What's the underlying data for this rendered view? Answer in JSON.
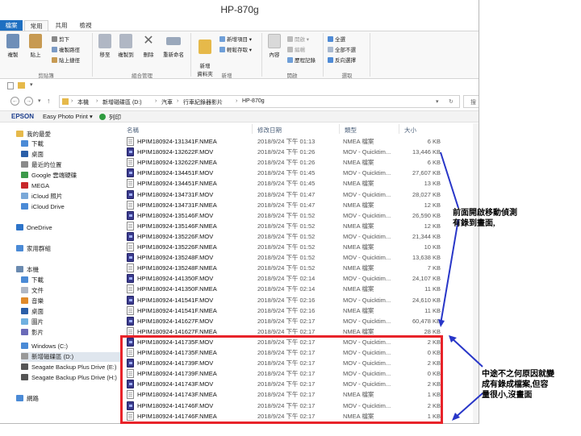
{
  "window": {
    "title": "HP-870g"
  },
  "tabs": [
    {
      "label": "檔案"
    },
    {
      "label": "常用"
    },
    {
      "label": "共用"
    },
    {
      "label": "檢視"
    }
  ],
  "ribbon": {
    "clipboard": {
      "copy": "複製",
      "paste": "貼上",
      "cut": "剪下",
      "copy_path": "複製路徑",
      "paste_shortcut": "貼上捷徑",
      "group": "剪貼簿"
    },
    "organize": {
      "move_to": "移至",
      "copy_to": "複製到",
      "delete": "刪除",
      "rename": "重新命名",
      "group": "組合管理"
    },
    "new": {
      "new_folder": "新增\n資料夾",
      "new_item": "新增項目 ▾",
      "easy_access": "輕鬆存取 ▾",
      "group": "新增"
    },
    "open": {
      "properties": "內容",
      "open": "開啟 ▾",
      "edit": "編輯",
      "history": "歷程記錄",
      "group": "開啟"
    },
    "select": {
      "select_all": "全選",
      "select_none": "全部不選",
      "invert": "反向選擇",
      "group": "選取"
    }
  },
  "address": {
    "crumbs": [
      "本機",
      "新增磁碟區 (D:)",
      "汽車",
      "行車紀錄器影片",
      "HP-870g"
    ],
    "search": "搜"
  },
  "epson": {
    "brand": "EPSON",
    "app": "Easy Photo Print ▾",
    "print": "列印"
  },
  "nav": [
    {
      "label": "我的最愛"
    },
    {
      "label": "下載"
    },
    {
      "label": "桌面"
    },
    {
      "label": "最近的位置"
    },
    {
      "label": "Google 雲端硬碟"
    },
    {
      "label": "MEGA"
    },
    {
      "label": "iCloud 照片"
    },
    {
      "label": "iCloud Drive"
    },
    {
      "label": "OneDrive"
    },
    {
      "label": "家用群組"
    },
    {
      "label": "本機"
    },
    {
      "label": "下載"
    },
    {
      "label": "文件"
    },
    {
      "label": "音樂"
    },
    {
      "label": "桌面"
    },
    {
      "label": "圖片"
    },
    {
      "label": "影片"
    },
    {
      "label": "Windows (C:)"
    },
    {
      "label": "新增磁碟區 (D:)"
    },
    {
      "label": "Seagate Backup Plus Drive (E:)"
    },
    {
      "label": "Seagate Backup Plus Drive (H:)"
    },
    {
      "label": "網路"
    }
  ],
  "columns": {
    "name": "名稱",
    "date": "修改日期",
    "type": "類型",
    "size": "大小"
  },
  "files": [
    {
      "name": "HPIM180924-131341F.NMEA",
      "date": "2018/9/24 下午 01:13",
      "type": "NMEA 檔案",
      "size": "6 KB",
      "kind": "nmea"
    },
    {
      "name": "HPIM180924-132622F.MOV",
      "date": "2018/9/24 下午 01:26",
      "type": "MOV - Quicktim...",
      "size": "13,446 KB",
      "kind": "mov"
    },
    {
      "name": "HPIM180924-132622F.NMEA",
      "date": "2018/9/24 下午 01:26",
      "type": "NMEA 檔案",
      "size": "6 KB",
      "kind": "nmea"
    },
    {
      "name": "HPIM180924-134451F.MOV",
      "date": "2018/9/24 下午 01:45",
      "type": "MOV - Quicktim...",
      "size": "27,607 KB",
      "kind": "mov"
    },
    {
      "name": "HPIM180924-134451F.NMEA",
      "date": "2018/9/24 下午 01:45",
      "type": "NMEA 檔案",
      "size": "13 KB",
      "kind": "nmea"
    },
    {
      "name": "HPIM180924-134731F.MOV",
      "date": "2018/9/24 下午 01:47",
      "type": "MOV - Quicktim...",
      "size": "28,027 KB",
      "kind": "mov"
    },
    {
      "name": "HPIM180924-134731F.NMEA",
      "date": "2018/9/24 下午 01:47",
      "type": "NMEA 檔案",
      "size": "12 KB",
      "kind": "nmea"
    },
    {
      "name": "HPIM180924-135146F.MOV",
      "date": "2018/9/24 下午 01:52",
      "type": "MOV - Quicktim...",
      "size": "26,590 KB",
      "kind": "mov"
    },
    {
      "name": "HPIM180924-135146F.NMEA",
      "date": "2018/9/24 下午 01:52",
      "type": "NMEA 檔案",
      "size": "12 KB",
      "kind": "nmea"
    },
    {
      "name": "HPIM180924-135226F.MOV",
      "date": "2018/9/24 下午 01:52",
      "type": "MOV - Quicktim...",
      "size": "21,344 KB",
      "kind": "mov"
    },
    {
      "name": "HPIM180924-135226F.NMEA",
      "date": "2018/9/24 下午 01:52",
      "type": "NMEA 檔案",
      "size": "10 KB",
      "kind": "nmea"
    },
    {
      "name": "HPIM180924-135248F.MOV",
      "date": "2018/9/24 下午 01:52",
      "type": "MOV - Quicktim...",
      "size": "13,638 KB",
      "kind": "mov"
    },
    {
      "name": "HPIM180924-135248F.NMEA",
      "date": "2018/9/24 下午 01:52",
      "type": "NMEA 檔案",
      "size": "7 KB",
      "kind": "nmea"
    },
    {
      "name": "HPIM180924-141350F.MOV",
      "date": "2018/9/24 下午 02:14",
      "type": "MOV - Quicktim...",
      "size": "24,107 KB",
      "kind": "mov"
    },
    {
      "name": "HPIM180924-141350F.NMEA",
      "date": "2018/9/24 下午 02:14",
      "type": "NMEA 檔案",
      "size": "11 KB",
      "kind": "nmea"
    },
    {
      "name": "HPIM180924-141541F.MOV",
      "date": "2018/9/24 下午 02:16",
      "type": "MOV - Quicktim...",
      "size": "24,610 KB",
      "kind": "mov"
    },
    {
      "name": "HPIM180924-141541F.NMEA",
      "date": "2018/9/24 下午 02:16",
      "type": "NMEA 檔案",
      "size": "11 KB",
      "kind": "nmea"
    },
    {
      "name": "HPIM180924-141627F.MOV",
      "date": "2018/9/24 下午 02:17",
      "type": "MOV - Quicktim...",
      "size": "60,478 KB",
      "kind": "mov"
    },
    {
      "name": "HPIM180924-141627F.NMEA",
      "date": "2018/9/24 下午 02:17",
      "type": "NMEA 檔案",
      "size": "28 KB",
      "kind": "nmea"
    },
    {
      "name": "HPIM180924-141735F.MOV",
      "date": "2018/9/24 下午 02:17",
      "type": "MOV - Quicktim...",
      "size": "2 KB",
      "kind": "mov"
    },
    {
      "name": "HPIM180924-141735F.NMEA",
      "date": "2018/9/24 下午 02:17",
      "type": "MOV - Quicktim...",
      "size": "0 KB",
      "kind": "nmea"
    },
    {
      "name": "HPIM180924-141739F.MOV",
      "date": "2018/9/24 下午 02:17",
      "type": "MOV - Quicktim...",
      "size": "2 KB",
      "kind": "mov"
    },
    {
      "name": "HPIM180924-141739F.NMEA",
      "date": "2018/9/24 下午 02:17",
      "type": "MOV - Quicktim...",
      "size": "0 KB",
      "kind": "nmea"
    },
    {
      "name": "HPIM180924-141743F.MOV",
      "date": "2018/9/24 下午 02:17",
      "type": "MOV - Quicktim...",
      "size": "2 KB",
      "kind": "mov"
    },
    {
      "name": "HPIM180924-141743F.NMEA",
      "date": "2018/9/24 下午 02:17",
      "type": "NMEA 檔案",
      "size": "1 KB",
      "kind": "nmea"
    },
    {
      "name": "HPIM180924-141746F.MOV",
      "date": "2018/9/24 下午 02:17",
      "type": "MOV - Quicktim...",
      "size": "2 KB",
      "kind": "mov"
    },
    {
      "name": "HPIM180924-141746F.NMEA",
      "date": "2018/9/24 下午 02:17",
      "type": "NMEA 檔案",
      "size": "1 KB",
      "kind": "nmea"
    }
  ],
  "annotations": {
    "note1": [
      "前面開啟移動偵測",
      "有錄到畫面,"
    ],
    "note2": [
      "中途不之何原因就變",
      "成有錄成檔案,但容",
      "量很小,沒畫面"
    ],
    "highlight_color": "#e8232a",
    "arrow_color": "#2836c8"
  }
}
